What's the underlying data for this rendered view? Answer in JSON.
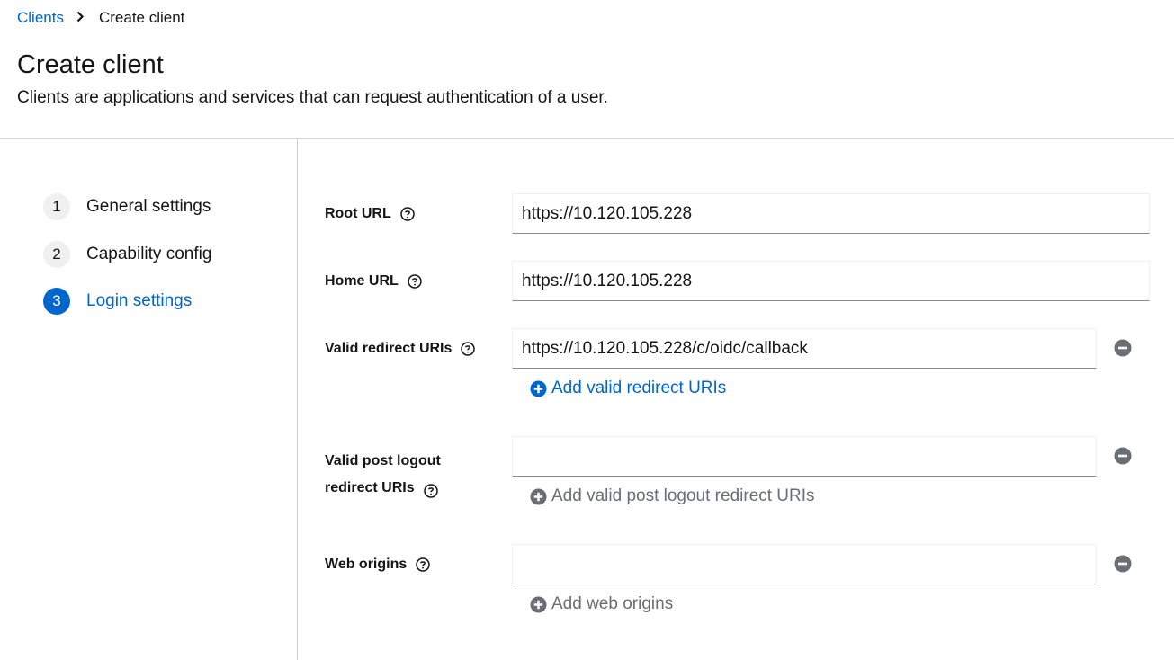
{
  "breadcrumb": {
    "parent": "Clients",
    "current": "Create client"
  },
  "page": {
    "title": "Create client",
    "description": "Clients are applications and services that can request authentication of a user."
  },
  "wizard": {
    "steps": [
      {
        "number": "1",
        "label": "General settings",
        "active": false
      },
      {
        "number": "2",
        "label": "Capability config",
        "active": false
      },
      {
        "number": "3",
        "label": "Login settings",
        "active": true
      }
    ]
  },
  "form": {
    "root_url": {
      "label": "Root URL",
      "value": "https://10.120.105.228"
    },
    "home_url": {
      "label": "Home URL",
      "value": "https://10.120.105.228"
    },
    "valid_redirect_uris": {
      "label": "Valid redirect URIs",
      "value": "https://10.120.105.228/c/oidc/callback",
      "add_label": "Add valid redirect URIs"
    },
    "valid_post_logout": {
      "label_line1": "Valid post logout",
      "label_line2": "redirect URIs",
      "value": "",
      "add_label": "Add valid post logout redirect URIs"
    },
    "web_origins": {
      "label": "Web origins",
      "value": "",
      "add_label": "Add web origins"
    }
  },
  "colors": {
    "accent": "#0066cc",
    "disabled": "#6a6e73",
    "border": "#d2d2d2"
  },
  "icons": [
    "chevron-right-icon",
    "help-icon",
    "minus-circle-icon",
    "plus-circle-icon"
  ]
}
